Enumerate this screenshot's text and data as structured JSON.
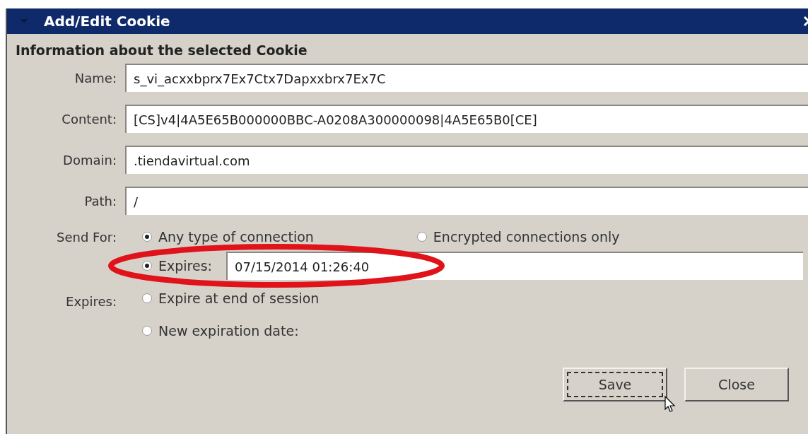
{
  "window": {
    "title": "Add/Edit Cookie"
  },
  "heading": "Information about the selected Cookie",
  "fields": [
    {
      "label": "Name:",
      "value": "s_vi_acxxbprx7Ex7Ctx7Dapxxbrx7Ex7C"
    },
    {
      "label": "Content:",
      "value": "[CS]v4|4A5E65B000000BBC-A0208A300000098|4A5E65B0[CE]"
    },
    {
      "label": "Domain:",
      "value": ".tiendavirtual.com"
    },
    {
      "label": "Path:",
      "value": "/"
    }
  ],
  "send_for": {
    "label": "Send For:",
    "options": [
      {
        "label": "Any type of connection",
        "selected": true
      },
      {
        "label": "Encrypted connections only",
        "selected": false
      }
    ]
  },
  "expires": {
    "label": "Expires:",
    "options": [
      {
        "label": "Expires:",
        "selected": true,
        "value": "07/15/2014 01:26:40",
        "highlighted": true
      },
      {
        "label": "Expire at end of session",
        "selected": false
      },
      {
        "label": "New expiration date:",
        "selected": false
      }
    ]
  },
  "buttons": [
    {
      "label": "Save",
      "focused": true
    },
    {
      "label": "Close",
      "focused": false
    }
  ]
}
